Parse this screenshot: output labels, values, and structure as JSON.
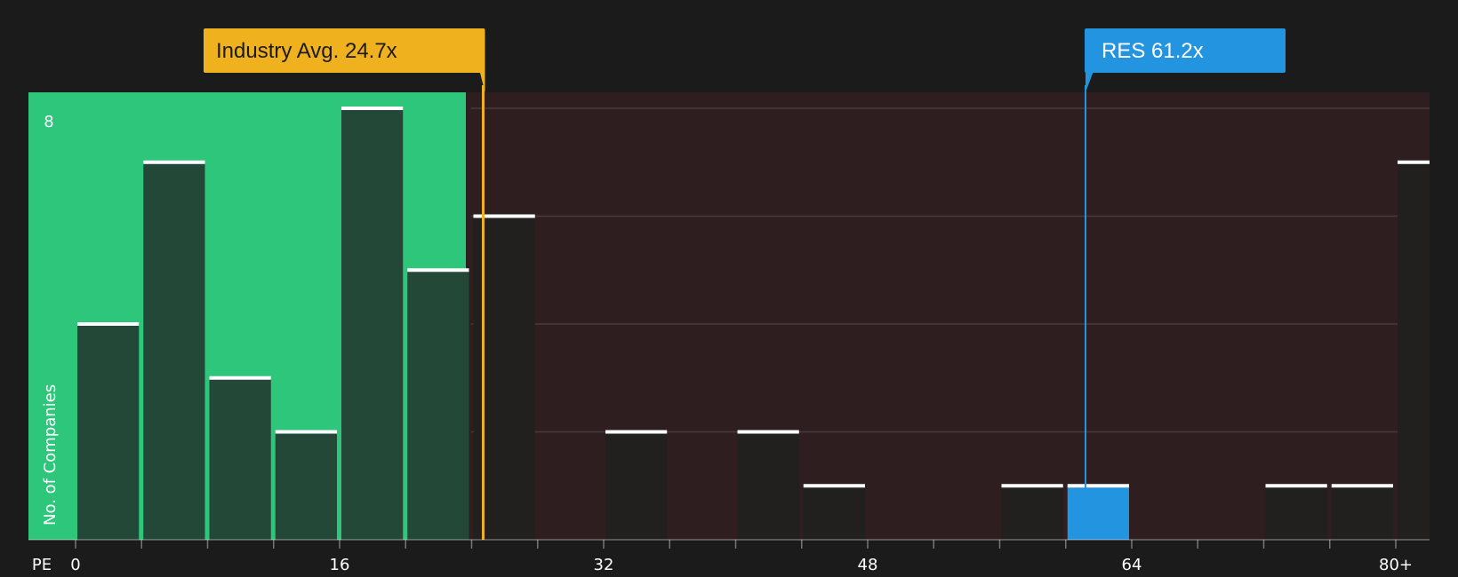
{
  "chart_data": {
    "type": "bar",
    "xlabel": "PE",
    "ylabel": "No. of Companies",
    "x_ticks": [
      "0",
      "16",
      "32",
      "48",
      "64",
      "80+"
    ],
    "y_ticks": [
      "8"
    ],
    "bin_width": 4,
    "bins": [
      {
        "start": 0,
        "count": 4
      },
      {
        "start": 4,
        "count": 7
      },
      {
        "start": 8,
        "count": 3
      },
      {
        "start": 12,
        "count": 2
      },
      {
        "start": 16,
        "count": 8
      },
      {
        "start": 20,
        "count": 5
      },
      {
        "start": 24,
        "count": 6
      },
      {
        "start": 28,
        "count": 0
      },
      {
        "start": 32,
        "count": 2
      },
      {
        "start": 36,
        "count": 0
      },
      {
        "start": 40,
        "count": 2
      },
      {
        "start": 44,
        "count": 1
      },
      {
        "start": 48,
        "count": 0
      },
      {
        "start": 52,
        "count": 0
      },
      {
        "start": 56,
        "count": 1
      },
      {
        "start": 60,
        "count": 1,
        "highlight": true
      },
      {
        "start": 64,
        "count": 0
      },
      {
        "start": 68,
        "count": 0
      },
      {
        "start": 72,
        "count": 1
      },
      {
        "start": 76,
        "count": 1
      },
      {
        "start": 80,
        "count": 7
      }
    ],
    "ylim": [
      0,
      8
    ],
    "grid": true,
    "industry_avg": {
      "value": 24.7,
      "label": "Industry Avg. 24.7x",
      "color": "#efb21e"
    },
    "company": {
      "value": 61.2,
      "label": "RES 61.2x",
      "color": "#2394e0"
    },
    "colors": {
      "good_zone": "#2dc67a",
      "bad_zone": "#2e1e1f",
      "bar_dark": "#234838",
      "bar_neutral": "#221f1f",
      "highlight_bar": "#2394e0",
      "background": "#1b1b1b"
    }
  }
}
